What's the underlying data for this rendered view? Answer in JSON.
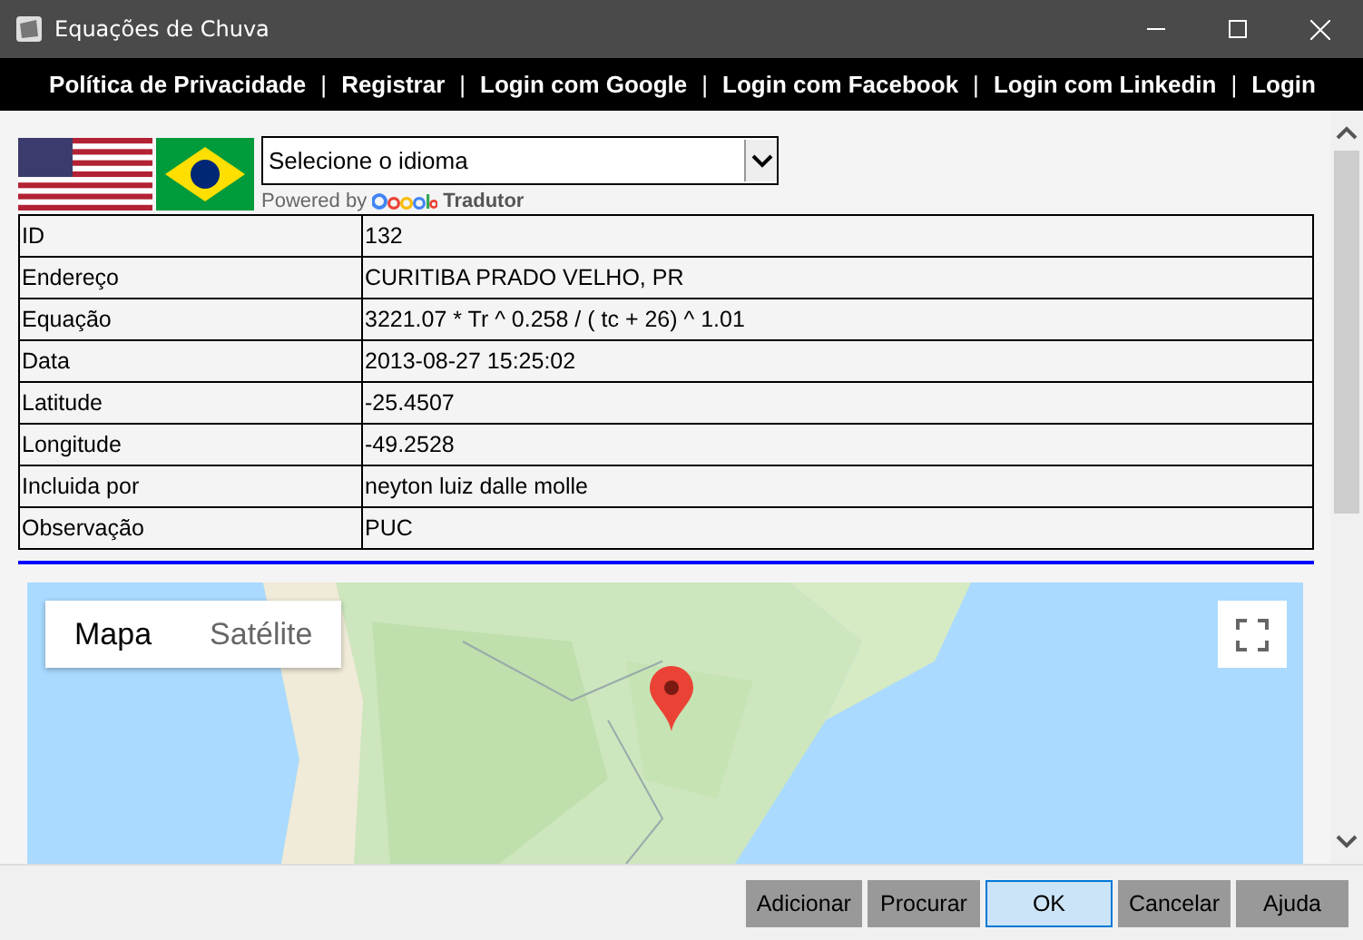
{
  "window": {
    "title": "Equações de Chuva"
  },
  "nav_links": [
    "Política de Privacidade",
    "Registrar",
    "Login com Google",
    "Login com Facebook",
    "Login com Linkedin",
    "Login"
  ],
  "nav_separator": "|",
  "language": {
    "placeholder": "Selecione o idioma",
    "powered_by": "Powered by",
    "provider": "Tradutor"
  },
  "details": [
    {
      "label": "ID",
      "value": "132"
    },
    {
      "label": "Endereço",
      "value": "CURITIBA PRADO VELHO, PR"
    },
    {
      "label": "Equação",
      "value": "3221.07 * Tr ^ 0.258 / ( tc + 26) ^ 1.01"
    },
    {
      "label": "Data",
      "value": "2013-08-27 15:25:02"
    },
    {
      "label": "Latitude",
      "value": "-25.4507"
    },
    {
      "label": "Longitude",
      "value": "-49.2528"
    },
    {
      "label": "Incluida por",
      "value": "neyton luiz dalle molle"
    },
    {
      "label": "Observação",
      "value": "PUC"
    }
  ],
  "map": {
    "map_types": [
      {
        "label": "Mapa",
        "selected": true
      },
      {
        "label": "Satélite",
        "selected": false
      }
    ]
  },
  "buttons": [
    {
      "label": "Adicionar",
      "kind": "normal"
    },
    {
      "label": "Procurar",
      "kind": "normal"
    },
    {
      "label": "OK",
      "kind": "default"
    },
    {
      "label": "Cancelar",
      "kind": "normal"
    },
    {
      "label": "Ajuda",
      "kind": "normal"
    }
  ]
}
